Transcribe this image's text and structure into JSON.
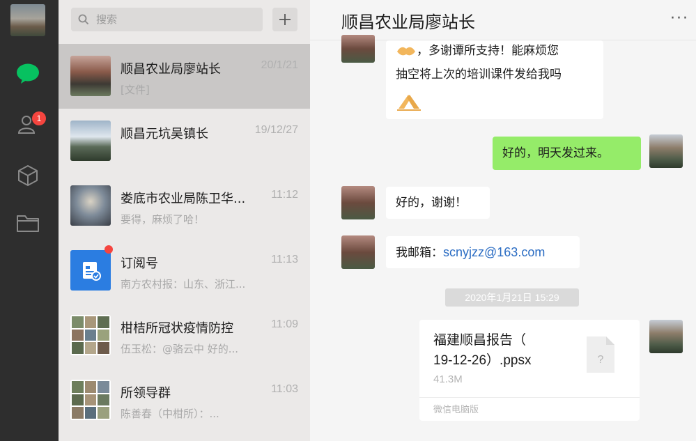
{
  "sidebar": {
    "contacts_badge": "1"
  },
  "search": {
    "placeholder": "搜索"
  },
  "conversations": [
    {
      "name": "顺昌农业局廖站长",
      "time": "20/1/21",
      "snippet": "[文件]"
    },
    {
      "name": "顺昌元坑吴镇长",
      "time": "19/12/27",
      "snippet": ""
    },
    {
      "name": "娄底市农业局陈卫华...",
      "time": "11:12",
      "snippet": "要得，麻烦了哈！"
    },
    {
      "name": "订阅号",
      "time": "11:13",
      "snippet": "南方农村报：山东、浙江..."
    },
    {
      "name": "柑桔所冠状疫情防控",
      "time": "11:09",
      "snippet": "伍玉松：@骆云中 好的..."
    },
    {
      "name": "所领导群",
      "time": "11:03",
      "snippet": "陈善春（中柑所）：..."
    }
  ],
  "chat": {
    "title": "顺昌农业局廖站长",
    "messages": {
      "m1_line1": "，多谢谭所支持！能麻烦您",
      "m1_line2": "抽空将上次的培训课件发给我吗",
      "m2": "好的，明天发过来。",
      "m3": "好的，谢谢！",
      "m4_prefix": "我邮箱：",
      "m4_email": "scnyjzz@163.com"
    },
    "timestamp": "2020年1月21日 15:29",
    "file": {
      "name_line1": "福建顺昌报告（",
      "name_line2": "19-12-26）.ppsx",
      "size": "41.3M",
      "source": "微信电脑版"
    }
  },
  "colors": {
    "rail_bg": "#2e2e2e",
    "accent_green": "#07c160",
    "bubble_green": "#95ec69",
    "badge_red": "#f5453f",
    "link_blue": "#2a6cc3"
  }
}
